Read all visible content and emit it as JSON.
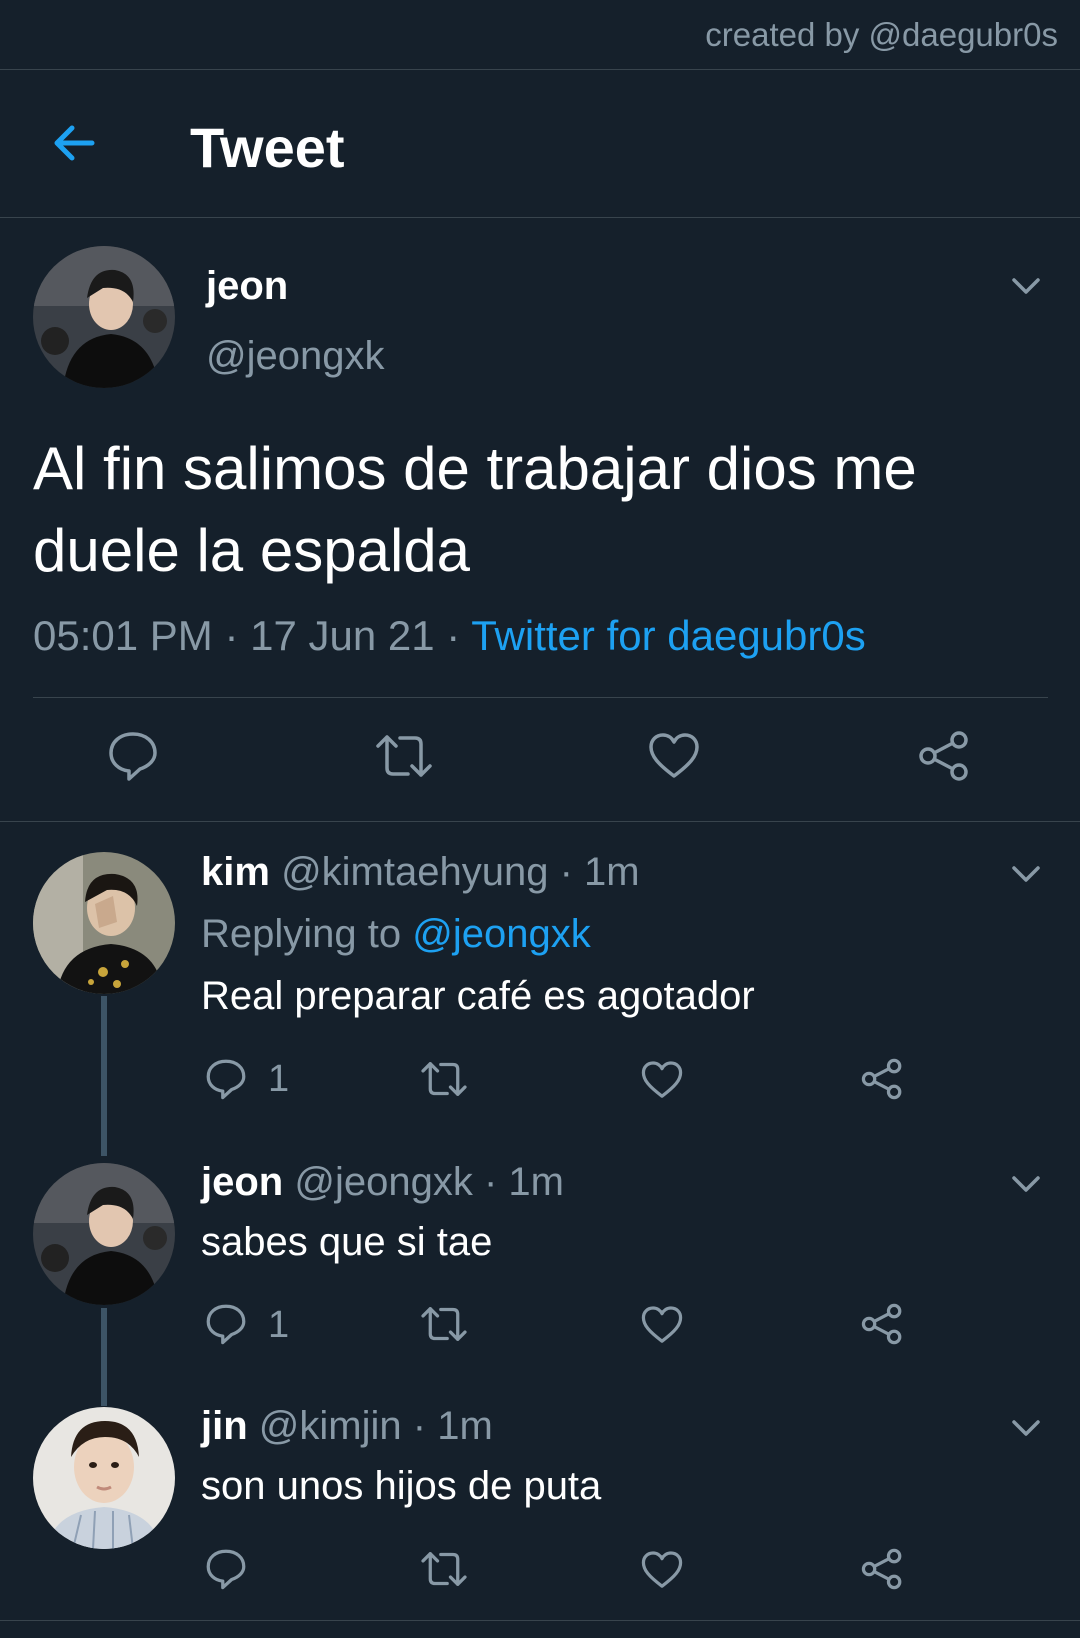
{
  "credit": "created by @daegubr0s",
  "header": {
    "title": "Tweet"
  },
  "main_tweet": {
    "name": "jeon",
    "handle": "@jeongxk",
    "text": "Al fin salimos de trabajar dios me duele la espalda",
    "time": "05:01 PM",
    "date": "17 Jun 21",
    "source": "Twitter for daegubr0s"
  },
  "separator": "·",
  "replies": [
    {
      "name": "kim",
      "handle": "@kimtaehyung",
      "age": "1m",
      "replying_label": "Replying to",
      "replying_to": "@jeongxk",
      "text": "Real preparar café es agotador",
      "reply_count": "1"
    },
    {
      "name": "jeon",
      "handle": "@jeongxk",
      "age": "1m",
      "text": "sabes que si tae",
      "reply_count": "1"
    },
    {
      "name": "jin",
      "handle": "@kimjin",
      "age": "1m",
      "text": "son unos hijos de puta",
      "reply_count": ""
    }
  ],
  "colors": {
    "background": "#15202b",
    "accent": "#1da1f2",
    "secondary_text": "#8899a6",
    "divider": "#38444d"
  },
  "icons": [
    "back-arrow-icon",
    "chevron-down-icon",
    "reply-icon",
    "retweet-icon",
    "like-icon",
    "share-icon"
  ]
}
